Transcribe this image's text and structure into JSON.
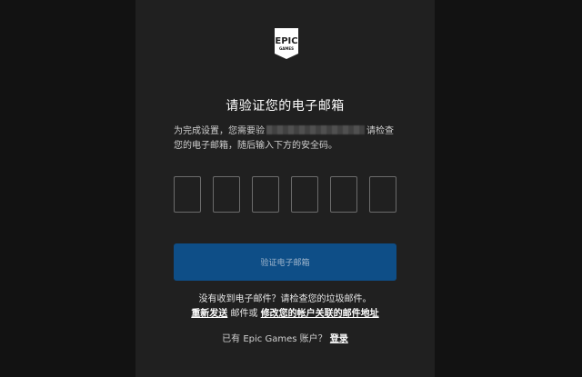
{
  "logo": {
    "line1": "EPIC",
    "line2": "GAMES",
    "icon": "epic-games-logo"
  },
  "title": "请验证您的电子邮箱",
  "description": {
    "prefix": "为完成设置，您需要验",
    "suffix": "请检查",
    "line2": "您的电子邮箱，随后输入下方的安全码。"
  },
  "code_boxes": [
    "",
    "",
    "",
    "",
    "",
    ""
  ],
  "verify_button": "验证电子邮箱",
  "help": {
    "no_email": "没有收到电子邮件？请检查您的垃圾邮件。",
    "resend": "重新发送",
    "or": "邮件或",
    "change_email": "修改您的帐户关联的邮件地址"
  },
  "signin": {
    "text": "已有 Epic Games 账户？",
    "link": "登录"
  },
  "colors": {
    "background": "#121212",
    "panel": "#202020",
    "button": "#0e4e87"
  }
}
